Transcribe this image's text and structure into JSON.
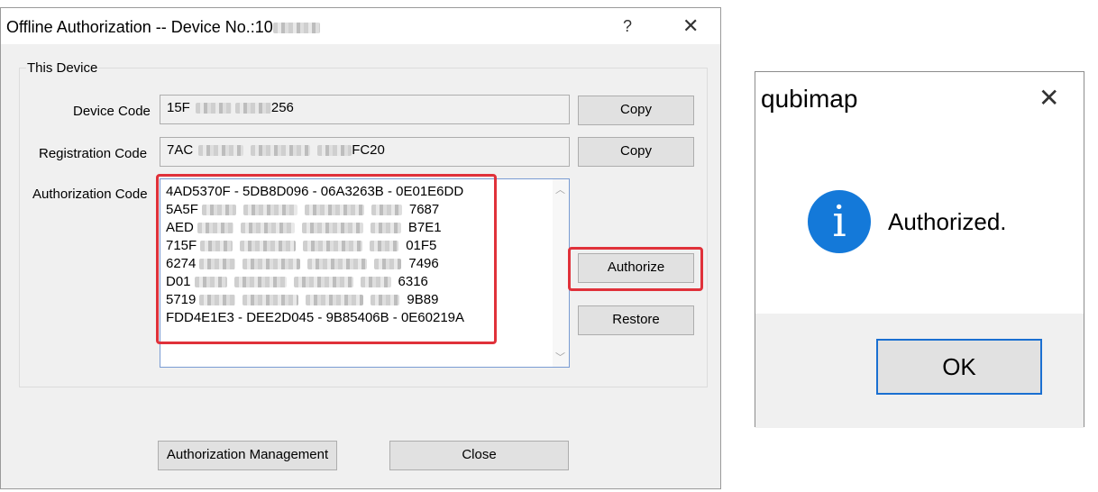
{
  "auth_dialog": {
    "title": "Offline Authorization -- Device No.:10",
    "help_glyph": "?",
    "close_glyph": "✕",
    "group_label": "This Device",
    "device_code_label": "Device Code",
    "device_code_prefix": "15F",
    "device_code_suffix": "256",
    "copy_label": "Copy",
    "registration_code_label": "Registration Code",
    "registration_code_prefix": "7AC",
    "registration_code_suffix": "FC20",
    "authorization_code_label": "Authorization Code",
    "code_lines": [
      {
        "prefix": "4AD5370F - 5DB8D096 - 06A3263B - 0E01E6DD",
        "suffix": ""
      },
      {
        "prefix": "5A5F",
        "suffix": "7687"
      },
      {
        "prefix": "AED",
        "suffix": "B7E1"
      },
      {
        "prefix": "715F",
        "suffix": "01F5"
      },
      {
        "prefix": "6274",
        "suffix": "7496"
      },
      {
        "prefix": "D01",
        "suffix": "6316"
      },
      {
        "prefix": "5719",
        "suffix": "9B89"
      },
      {
        "prefix": "FDD4E1E3 - DEE2D045 - 9B85406B - 0E60219A",
        "suffix": ""
      }
    ],
    "authorize_label": "Authorize",
    "restore_label": "Restore",
    "auth_management_label": "Authorization Management",
    "close_label": "Close"
  },
  "message_box": {
    "title": "qubimap",
    "close_glyph": "✕",
    "icon": "info-icon",
    "icon_glyph": "i",
    "message": "Authorized.",
    "ok_label": "OK",
    "icon_color": "#1479d9"
  },
  "highlight_color": "#e0313a"
}
